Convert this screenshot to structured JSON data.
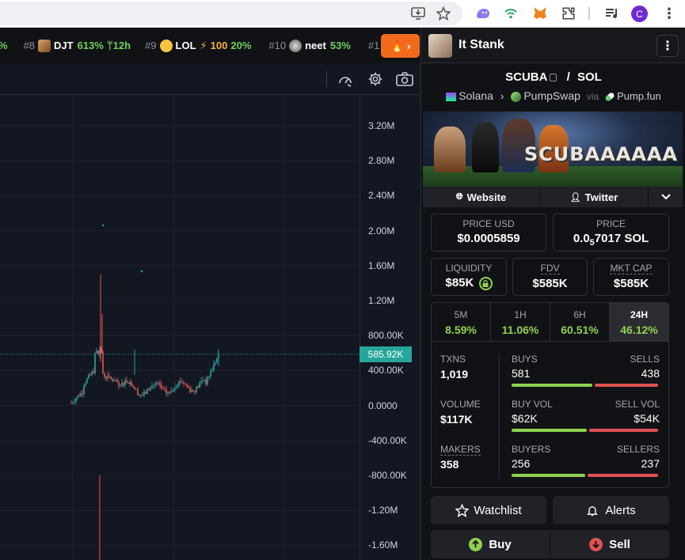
{
  "browser": {
    "icons": [
      "install-icon",
      "star-icon",
      "extension-purple-icon",
      "extension-wifi-icon",
      "metamask-icon",
      "puzzle-icon",
      "media-icon"
    ],
    "profile_initial": "C"
  },
  "ticker": [
    {
      "rank": "#8",
      "symbol": "DJT",
      "change": "613%",
      "age": "12h"
    },
    {
      "rank": "#9",
      "symbol": "LOL",
      "boost": "100",
      "change": "20%"
    },
    {
      "rank": "#10",
      "symbol": "neet",
      "change": "53%"
    }
  ],
  "ticker_partial": {
    "left": "%",
    "right": "#1"
  },
  "fire_button": "🔥 ›",
  "chart": {
    "y_ticks": [
      "3.20M",
      "2.80M",
      "2.40M",
      "2.00M",
      "1.60M",
      "1.20M",
      "800.00K",
      "400.00K",
      "0.0000",
      "-400.00K",
      "-800.00K",
      "-1.20M",
      "-1.60M"
    ],
    "current_value": "585.92K",
    "up_color": "#26a69a",
    "down_color": "#ef5350"
  },
  "panel": {
    "username": "It Stank",
    "pair": {
      "base": "SCUBA",
      "quote": "SOL",
      "separator": "/"
    },
    "chain": "Solana",
    "dex": "PumpSwap",
    "via": "via",
    "launchpad": "Pump.fun",
    "banner_text": "SCUBAAAAAA",
    "links": {
      "website": "Website",
      "twitter": "Twitter"
    },
    "price_usd": {
      "label": "PRICE USD",
      "value": "$0.0005859"
    },
    "price_sol": {
      "label": "PRICE",
      "prefix": "0.0",
      "sub": "5",
      "rest": "7017 SOL"
    },
    "liquidity": {
      "label": "LIQUIDITY",
      "value": "$85K"
    },
    "fdv": {
      "label": "FDV",
      "value": "$585K"
    },
    "mktcap": {
      "label": "MKT CAP",
      "value": "$585K"
    },
    "timeframes": [
      {
        "label": "5M",
        "value": "8.59%"
      },
      {
        "label": "1H",
        "value": "11.06%"
      },
      {
        "label": "6H",
        "value": "60.51%"
      },
      {
        "label": "24H",
        "value": "46.12%"
      }
    ],
    "active_timeframe": "24H",
    "stats": {
      "txns": {
        "label": "TXNS",
        "value": "1,019"
      },
      "buys": {
        "label": "BUYS",
        "value": "581",
        "ratio": 0.57
      },
      "sells": {
        "label": "SELLS",
        "value": "438"
      },
      "volume": {
        "label": "VOLUME",
        "value": "$117K"
      },
      "buy_vol": {
        "label": "BUY VOL",
        "value": "$62K",
        "ratio": 0.53
      },
      "sell_vol": {
        "label": "SELL VOL",
        "value": "$54K"
      },
      "makers": {
        "label": "MAKERS",
        "value": "358"
      },
      "buyers": {
        "label": "BUYERS",
        "value": "256",
        "ratio": 0.52
      },
      "sellers": {
        "label": "SELLERS",
        "value": "237"
      }
    },
    "buttons": {
      "watchlist": "Watchlist",
      "alerts": "Alerts",
      "buy": "Buy",
      "sell": "Sell"
    },
    "colors": {
      "green": "#8fd14f",
      "red": "#e05252"
    }
  }
}
